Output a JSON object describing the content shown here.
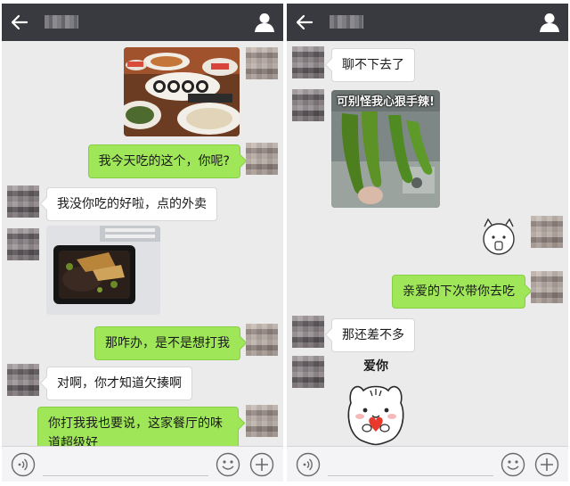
{
  "left_chat": {
    "messages": {
      "m2": "我今天吃的这个，你呢?",
      "m3": "我没你吃的好啦，点的外卖",
      "m5": "那咋办，是不是想打我",
      "m6": "对啊，你才知道欠揍啊",
      "m7": "你打我我也要说，这家餐厅的味道超级好"
    }
  },
  "right_chat": {
    "messages": {
      "m1": "聊不下去了",
      "m2_caption": "可别怪我心狠手辣!",
      "m4": "亲爱的下次带你去吃",
      "m5": "那还差不多",
      "m6_caption": "爱你"
    }
  },
  "colors": {
    "titlebar": "#393a3f",
    "chat_background": "#ebebeb",
    "outgoing_bubble": "#9fe658",
    "incoming_bubble": "#ffffff",
    "input_bar": "#f4f4f6"
  },
  "icons": [
    "back-arrow-icon",
    "profile-icon",
    "voice-icon",
    "emoji-icon",
    "plus-icon"
  ]
}
